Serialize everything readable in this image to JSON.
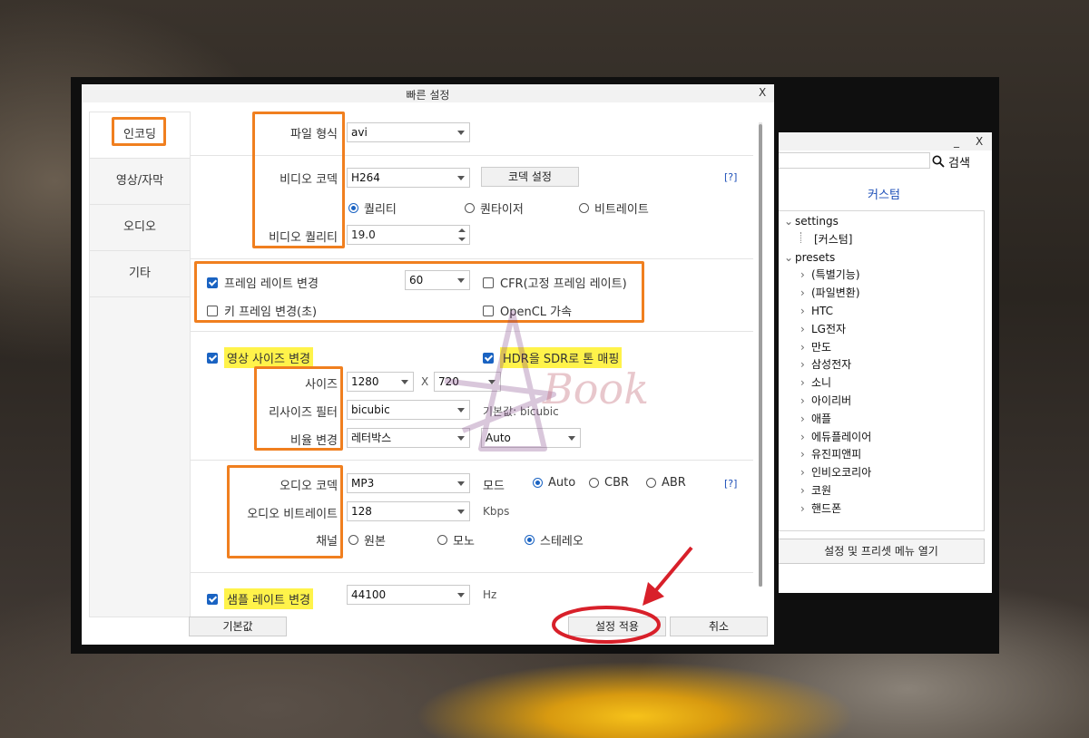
{
  "back_window": {
    "minimize": "_",
    "close": "X",
    "search_placeholder": "",
    "search_label": "검색",
    "custom_label": "커스텀",
    "tree": [
      {
        "label": "settings",
        "arrow": "⌄",
        "level": 0
      },
      {
        "label": "[커스텀]",
        "arrow": "",
        "level": 1
      },
      {
        "label": "presets",
        "arrow": "⌄",
        "level": 0
      },
      {
        "label": "(특별기능)",
        "arrow": "›",
        "level": 1
      },
      {
        "label": "(파일변환)",
        "arrow": "›",
        "level": 1
      },
      {
        "label": "HTC",
        "arrow": "›",
        "level": 1
      },
      {
        "label": "LG전자",
        "arrow": "›",
        "level": 1
      },
      {
        "label": "만도",
        "arrow": "›",
        "level": 1
      },
      {
        "label": "삼성전자",
        "arrow": "›",
        "level": 1
      },
      {
        "label": "소니",
        "arrow": "›",
        "level": 1
      },
      {
        "label": "아이리버",
        "arrow": "›",
        "level": 1
      },
      {
        "label": "애플",
        "arrow": "›",
        "level": 1
      },
      {
        "label": "에듀플레이어",
        "arrow": "›",
        "level": 1
      },
      {
        "label": "유진피앤피",
        "arrow": "›",
        "level": 1
      },
      {
        "label": "인비오코리아",
        "arrow": "›",
        "level": 1
      },
      {
        "label": "코원",
        "arrow": "›",
        "level": 1
      },
      {
        "label": "핸드폰",
        "arrow": "›",
        "level": 1
      }
    ],
    "menu_button": "설정 및 프리셋 메뉴 열기"
  },
  "dialog": {
    "title": "빠른 설정",
    "close": "X",
    "tabs": [
      "인코딩",
      "영상/자막",
      "오디오",
      "기타"
    ],
    "active_tab": 0,
    "file_format": {
      "label": "파일 형식",
      "value": "avi"
    },
    "video_codec": {
      "label": "비디오 코덱",
      "value": "H264",
      "settings_button": "코덱 설정",
      "help": "[?]"
    },
    "rate_modes": [
      "퀄리티",
      "퀀타이저",
      "비트레이트"
    ],
    "rate_mode_selected": 0,
    "video_quality": {
      "label": "비디오 퀄리티",
      "value": "19.0"
    },
    "framerate": {
      "label": "프레임 레이트 변경",
      "checked": true,
      "value": "60"
    },
    "cfr": {
      "label": "CFR(고정 프레임 레이트)",
      "checked": false
    },
    "keyframe": {
      "label": "키 프레임 변경(초)",
      "checked": false
    },
    "opencl": {
      "label": "OpenCL 가속",
      "checked": false
    },
    "resize": {
      "label": "영상 사이즈 변경",
      "checked": true
    },
    "hdr": {
      "label": "HDR을 SDR로 톤 매핑",
      "checked": true
    },
    "size": {
      "label": "사이즈",
      "width": "1280",
      "sep": "X",
      "height": "720"
    },
    "resize_filter": {
      "label": "리사이즈 필터",
      "value": "bicubic",
      "default_text": "기본값: bicubic"
    },
    "aspect": {
      "label": "비율 변경",
      "value": "레터박스",
      "value2": "Auto"
    },
    "audio_codec": {
      "label": "오디오 코덱",
      "value": "MP3",
      "mode_label": "모드",
      "help": "[?]"
    },
    "audio_modes": [
      "Auto",
      "CBR",
      "ABR"
    ],
    "audio_mode_selected": 0,
    "audio_bitrate": {
      "label": "오디오 비트레이트",
      "value": "128",
      "unit": "Kbps"
    },
    "channel": {
      "label": "채널"
    },
    "channels": [
      "원본",
      "모노",
      "스테레오"
    ],
    "channel_selected": 2,
    "samplerate": {
      "label": "샘플 레이트 변경",
      "checked": true,
      "value": "44100",
      "unit": "Hz"
    },
    "buttons": {
      "default": "기본값",
      "apply": "설정 적용",
      "cancel": "취소"
    }
  },
  "watermark": "Book",
  "colors": {
    "annotation_orange": "#f07f1f",
    "annotation_red": "#d8202a",
    "highlight_yellow": "#fff34a",
    "accent_blue": "#1a63c2"
  }
}
